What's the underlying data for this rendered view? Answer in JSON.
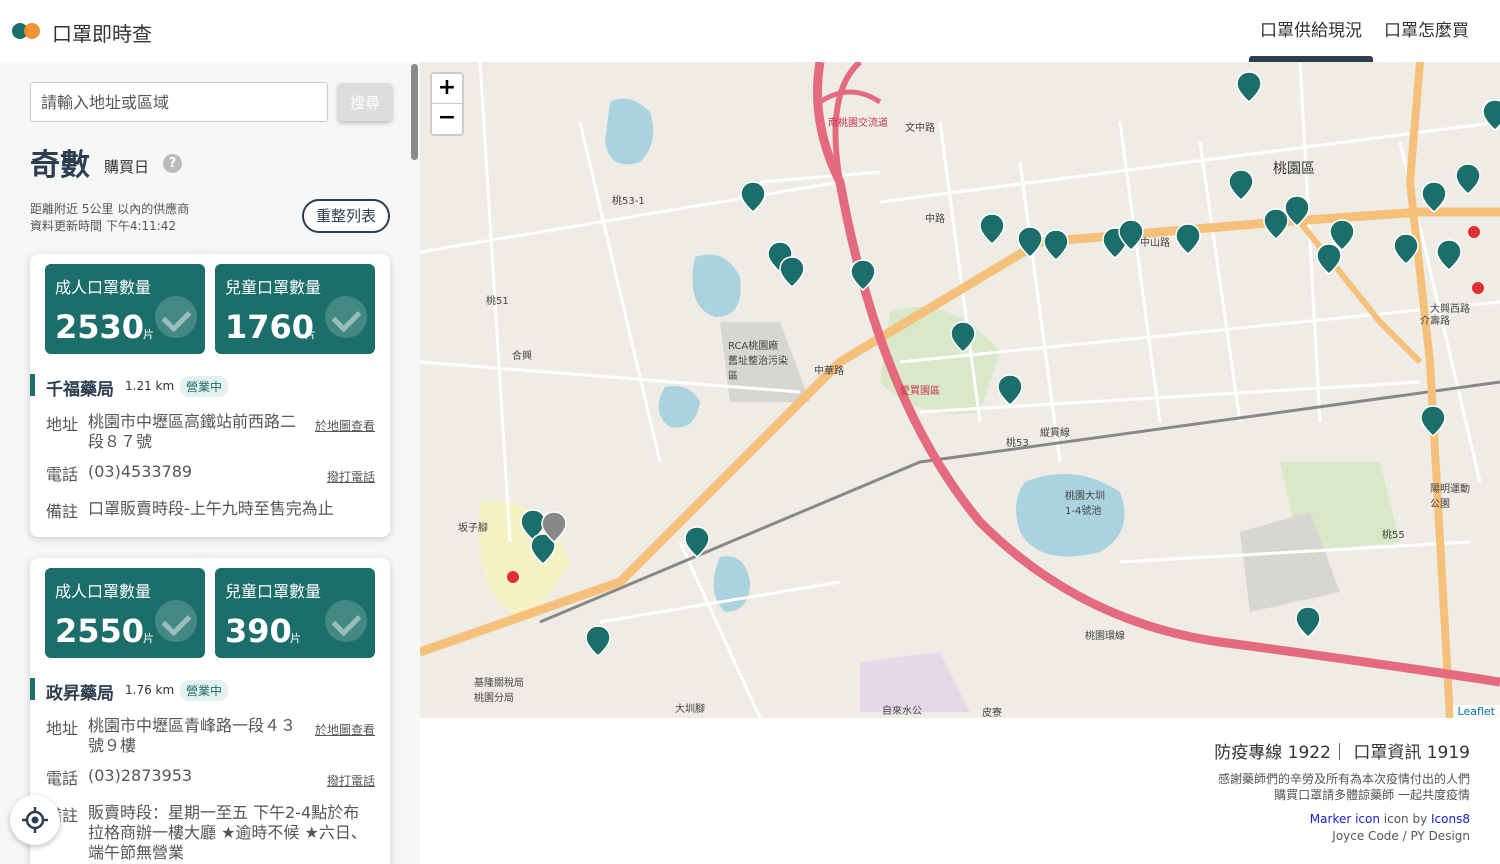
{
  "header": {
    "title": "口罩即時查",
    "nav": [
      "口罩供給現況",
      "口罩怎麼買"
    ]
  },
  "sidebar": {
    "search": {
      "placeholder": "請輸入地址或區域",
      "button": "搜尋"
    },
    "day_type": "奇數",
    "day_suffix": "購買日",
    "help": "?",
    "info_range": "距離附近 5公里 以內的供應商",
    "info_updated": "資料更新時間 下午4:11:42",
    "reset_button": "重整列表",
    "unit": "片",
    "labels": {
      "adult": "成人口罩數量",
      "child": "兒童口罩數量",
      "address": "地址",
      "phone": "電話",
      "note": "備註",
      "map_link": "於地圖查看",
      "call_link": "撥打電話"
    },
    "stores": [
      {
        "name": "千福藥局",
        "distance": "1.21 km",
        "status": "營業中",
        "adult": "2530",
        "child": "1760",
        "address": "桃園市中壢區高鐵站前西路二段８７號",
        "phone": "(03)4533789",
        "note": "口罩販賣時段-上午九時至售完為止"
      },
      {
        "name": "政昇藥局",
        "distance": "1.76 km",
        "status": "營業中",
        "adult": "2550",
        "child": "390",
        "address": "桃園市中壢區青峰路一段４３號９樓",
        "phone": "(03)2873953",
        "note": "販賣時段：星期一至五 下午2-4點於布拉格商辦一樓大廳 ★逾時不候 ★六日、端午節無營業"
      }
    ]
  },
  "map": {
    "zoom_in": "+",
    "zoom_out": "−",
    "attribution": "Leaflet",
    "labels": [
      "南桃園交流道",
      "文中路",
      "桃園區",
      "中山路",
      "中華路",
      "桃園環線",
      "縱貫線",
      "桃園大圳1-4號池",
      "桃園區",
      "愛買園區",
      "RCA桃園廠舊址整治污染區",
      "合興",
      "坂子腳",
      "基隆關稅局桃園分局",
      "大圳腳",
      "陽明運動公園",
      "桃53-1",
      "桃51",
      "桃53",
      "桃55",
      "自來水公",
      "皮寮",
      "中路",
      "大興西路",
      "介壽路",
      "桃園大圳"
    ]
  },
  "footer": {
    "hotline": "防疫專線 1922｜ 口罩資訊 1919",
    "thanks1": "感謝藥師們的辛勞及所有為本次疫情付出的人們",
    "thanks2": "購買口罩請多體諒藥師 一起共度疫情",
    "credit_marker": "Marker icon",
    "credit_by": " icon by ",
    "credit_icons8": "Icons8",
    "credit_design": "Joyce Code / PY Design"
  },
  "colors": {
    "primary": "#1b6e6a",
    "dark": "#2c3e50",
    "accent": "#f28c28",
    "highway": "#e46b7d",
    "main_road": "#f5c07a"
  }
}
